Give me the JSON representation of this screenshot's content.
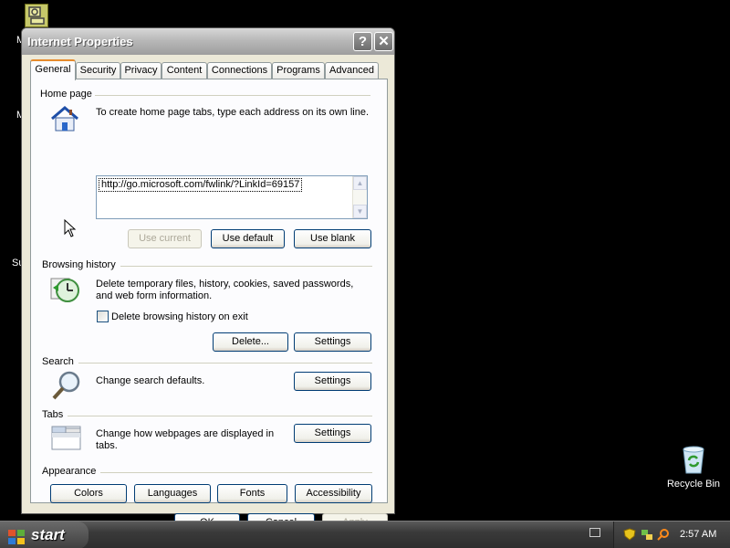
{
  "window": {
    "title": "Internet Properties",
    "help_glyph": "?",
    "close_glyph": "✕"
  },
  "tabs": [
    "General",
    "Security",
    "Privacy",
    "Content",
    "Connections",
    "Programs",
    "Advanced"
  ],
  "active_tab": "General",
  "home_page": {
    "group_label": "Home page",
    "description": "To create home page tabs, type each address on its own line.",
    "url_value": "http://go.microsoft.com/fwlink/?LinkId=69157",
    "use_current": "Use current",
    "use_default": "Use default",
    "use_blank": "Use blank"
  },
  "browsing_history": {
    "group_label": "Browsing history",
    "description_line1": "Delete temporary files, history, cookies, saved passwords,",
    "description_line2": "and web form information.",
    "checkbox_label": "Delete browsing history on exit",
    "checkbox_checked": false,
    "delete_button": "Delete...",
    "settings_button": "Settings"
  },
  "search": {
    "group_label": "Search",
    "description": "Change search defaults.",
    "settings_button": "Settings"
  },
  "tabs_section": {
    "group_label": "Tabs",
    "description_line1": "Change how webpages are displayed in",
    "description_line2": "tabs.",
    "settings_button": "Settings"
  },
  "appearance": {
    "group_label": "Appearance",
    "colors": "Colors",
    "languages": "Languages",
    "fonts": "Fonts",
    "accessibility": "Accessibility"
  },
  "dialog_buttons": {
    "ok": "OK",
    "cancel": "Cancel",
    "apply": "Apply"
  },
  "desktop": {
    "recycle_bin_label": "Recycle Bin",
    "fragment_1": "M",
    "fragment_2": "M",
    "fragment_3": "Su"
  },
  "taskbar": {
    "start_label": "start",
    "clock": "2:57 AM"
  },
  "colors": {
    "dialog_bg": "#ece9d8",
    "tab_accent": "#e68b2c",
    "button_border": "#003c74"
  }
}
